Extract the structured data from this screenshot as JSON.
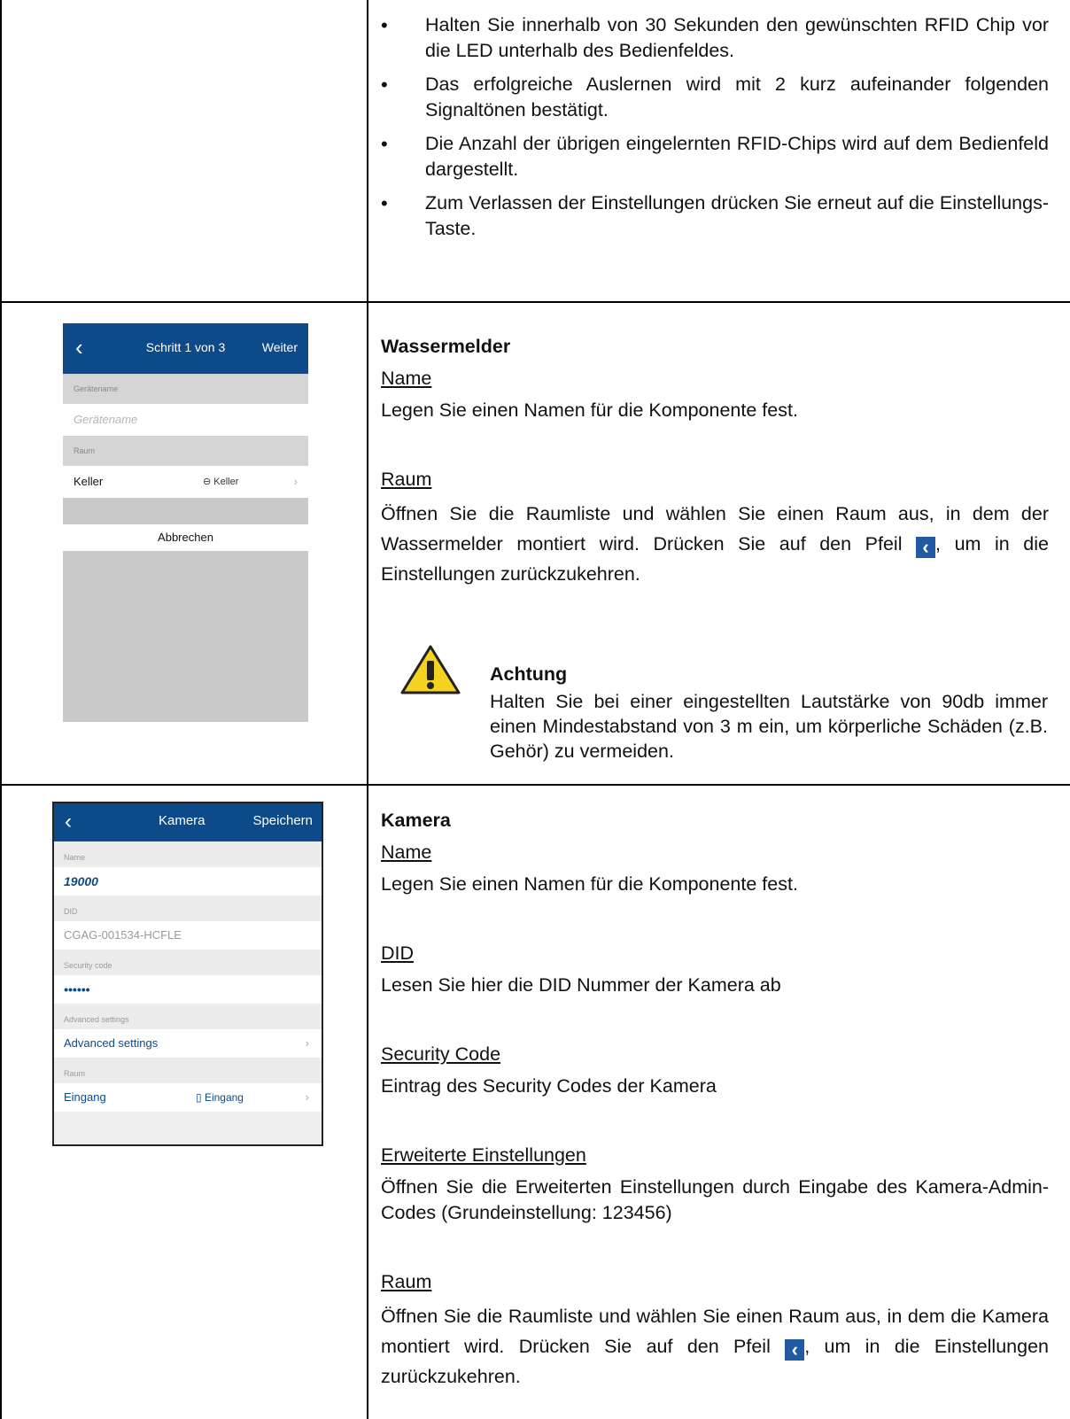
{
  "row1": {
    "bullets": [
      "Halten Sie innerhalb von 30 Sekunden den gewünschten RFID Chip vor die LED unterhalb des Bedienfeldes.",
      "Das erfolgreiche Auslernen wird mit 2 kurz aufeinander folgenden Signaltönen bestätigt.",
      "Die Anzahl der übrigen eingelernten RFID-Chips wird auf dem Bedienfeld dargestellt.",
      "Zum Verlassen der Einstellungen drücken Sie erneut auf die Einstellungs-Taste."
    ]
  },
  "row2": {
    "heading": "Wassermelder",
    "name_heading": "Name",
    "name_text": "Legen Sie einen Namen für die Komponente fest.",
    "raum_heading": "Raum",
    "raum_text_1": "Öffnen Sie die Raumliste und wählen Sie einen Raum aus, in dem der Wassermelder montiert wird. Drücken Sie auf den Pfeil",
    "raum_text_2": ", um in die Einstellungen zurückzukehren.",
    "warning_title": "Achtung",
    "warning_text": "Halten Sie bei einer eingestellten Lautstärke von 90db immer einen Mindestabstand von 3 m ein, um körperliche Schäden (z.B. Gehör) zu vermeiden.",
    "phone": {
      "title": "Schritt 1 von 3",
      "action": "Weiter",
      "label_name": "Gerätename",
      "placeholder_name": "Gerätename",
      "label_raum": "Raum",
      "raum_value": "Keller",
      "raum_right": "Keller",
      "cancel": "Abbrechen"
    }
  },
  "row3": {
    "heading": "Kamera",
    "name_heading": "Name",
    "name_text": "Legen Sie einen Namen für die Komponente fest.",
    "did_heading": "DID",
    "did_text": "Lesen Sie hier die DID Nummer der Kamera ab",
    "sec_heading": "Security Code",
    "sec_text": "Eintrag des Security Codes der Kamera",
    "adv_heading": "Erweiterte Einstellungen",
    "adv_text": "Öffnen Sie die Erweiterten Einstellungen durch Eingabe des Kamera-Admin-Codes (Grundeinstellung: 123456)",
    "raum_heading": "Raum",
    "raum_text_1": "Öffnen Sie die Raumliste und wählen Sie einen Raum aus, in dem die Kamera montiert wird. Drücken Sie auf den Pfeil",
    "raum_text_2": ", um in die Einstellungen zurückzukehren.",
    "phone": {
      "title": "Kamera",
      "action": "Speichern",
      "label_name": "Name",
      "name_value": "19000",
      "label_did": "DID",
      "did_value": "CGAG-001534-HCFLE",
      "label_sec": "Security code",
      "sec_value": "••••••",
      "label_adv": "Advanced settings",
      "adv_value": "Advanced settings",
      "label_raum": "Raum",
      "raum_value": "Eingang",
      "raum_right": "Eingang"
    }
  }
}
